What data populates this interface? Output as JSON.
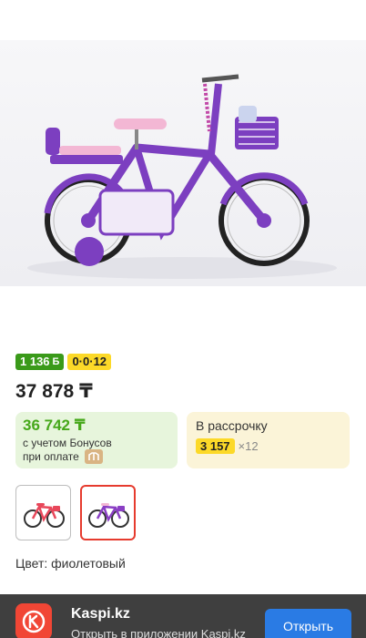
{
  "badges": {
    "bonus_label": "1 136",
    "bonus_symbol": "Б",
    "installment_label": "0·0·12"
  },
  "product": {
    "price": "37 878 ₸",
    "color_label": "Цвет: фиолетовый"
  },
  "bonus_card": {
    "price": "36 742 ₸",
    "note_line1": "с учетом Бонусов",
    "note_line2": "при оплате"
  },
  "installment_card": {
    "title": "В рассрочку",
    "amount": "3 157",
    "months": "×12"
  },
  "thumbnails": [
    {
      "color": "#e8475a",
      "selected": false
    },
    {
      "color": "#8a3fc4",
      "selected": true
    }
  ],
  "banner": {
    "title": "Kaspi.kz",
    "subtitle": "Открыть в приложении Kaspi.kz",
    "open_label": "Открыть"
  },
  "colors": {
    "accent_red": "#e63b2e",
    "bonus_green": "#3a9a1a",
    "installment_yellow": "#fcd928",
    "button_blue": "#2a7be4",
    "bike_purple": "#7c3fc0"
  }
}
